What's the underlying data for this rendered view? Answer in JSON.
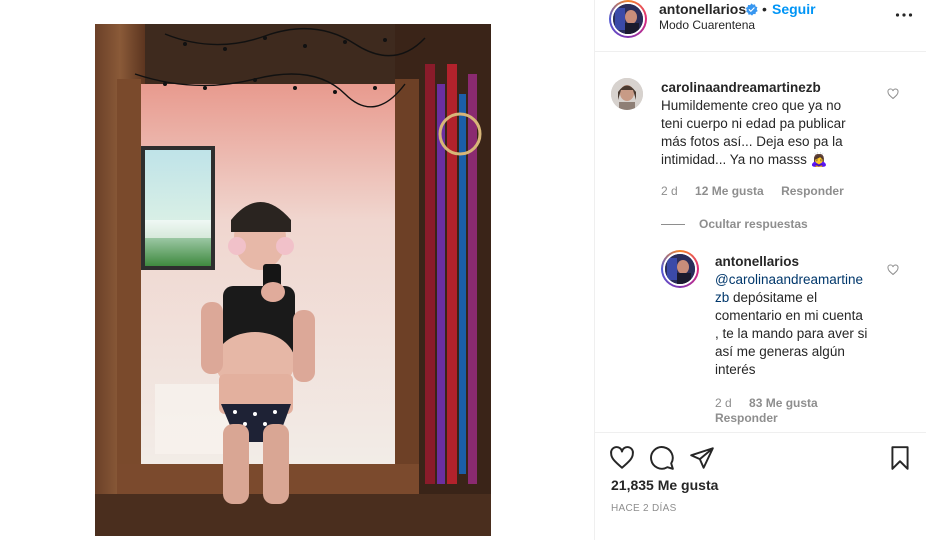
{
  "post": {
    "username": "antonellarios",
    "follow_label": "Seguir",
    "subtitle": "Modo Cuarentena",
    "dot": "•",
    "likes": "21,835 Me gusta",
    "posted_ago": "HACE 2 DÍAS"
  },
  "comments": [
    {
      "username": "carolinaandreamartinezb",
      "text": "Humildemente creo que ya no\nteni cuerpo ni edad pa publicar\nmás fotos así... Deja eso pa la\nintimidad... Ya no masss 🙇‍♀️",
      "time": "2 d",
      "likes": "12 Me gusta",
      "reply_label": "Responder",
      "hide_replies_label": "Ocultar respuestas"
    }
  ],
  "reply": {
    "username": "antonellarios",
    "mention": "@carolinaandreamartine\nzb",
    "text": " depósitame el\ncomentario en mi cuenta\n, te la mando para aver si\nasí me generas algún\ninterés",
    "time": "2 d",
    "likes": "83 Me gusta",
    "reply_label": "Responder"
  },
  "icons": {
    "verified": "verified-badge-icon",
    "more": "more-options-icon",
    "like": "heart-icon",
    "comment": "comment-bubble-icon",
    "share": "paper-plane-icon",
    "save": "bookmark-icon"
  },
  "colors": {
    "link_blue": "#0095f6",
    "mention_blue": "#00376b",
    "muted": "#8e8e8e",
    "text": "#262626"
  }
}
